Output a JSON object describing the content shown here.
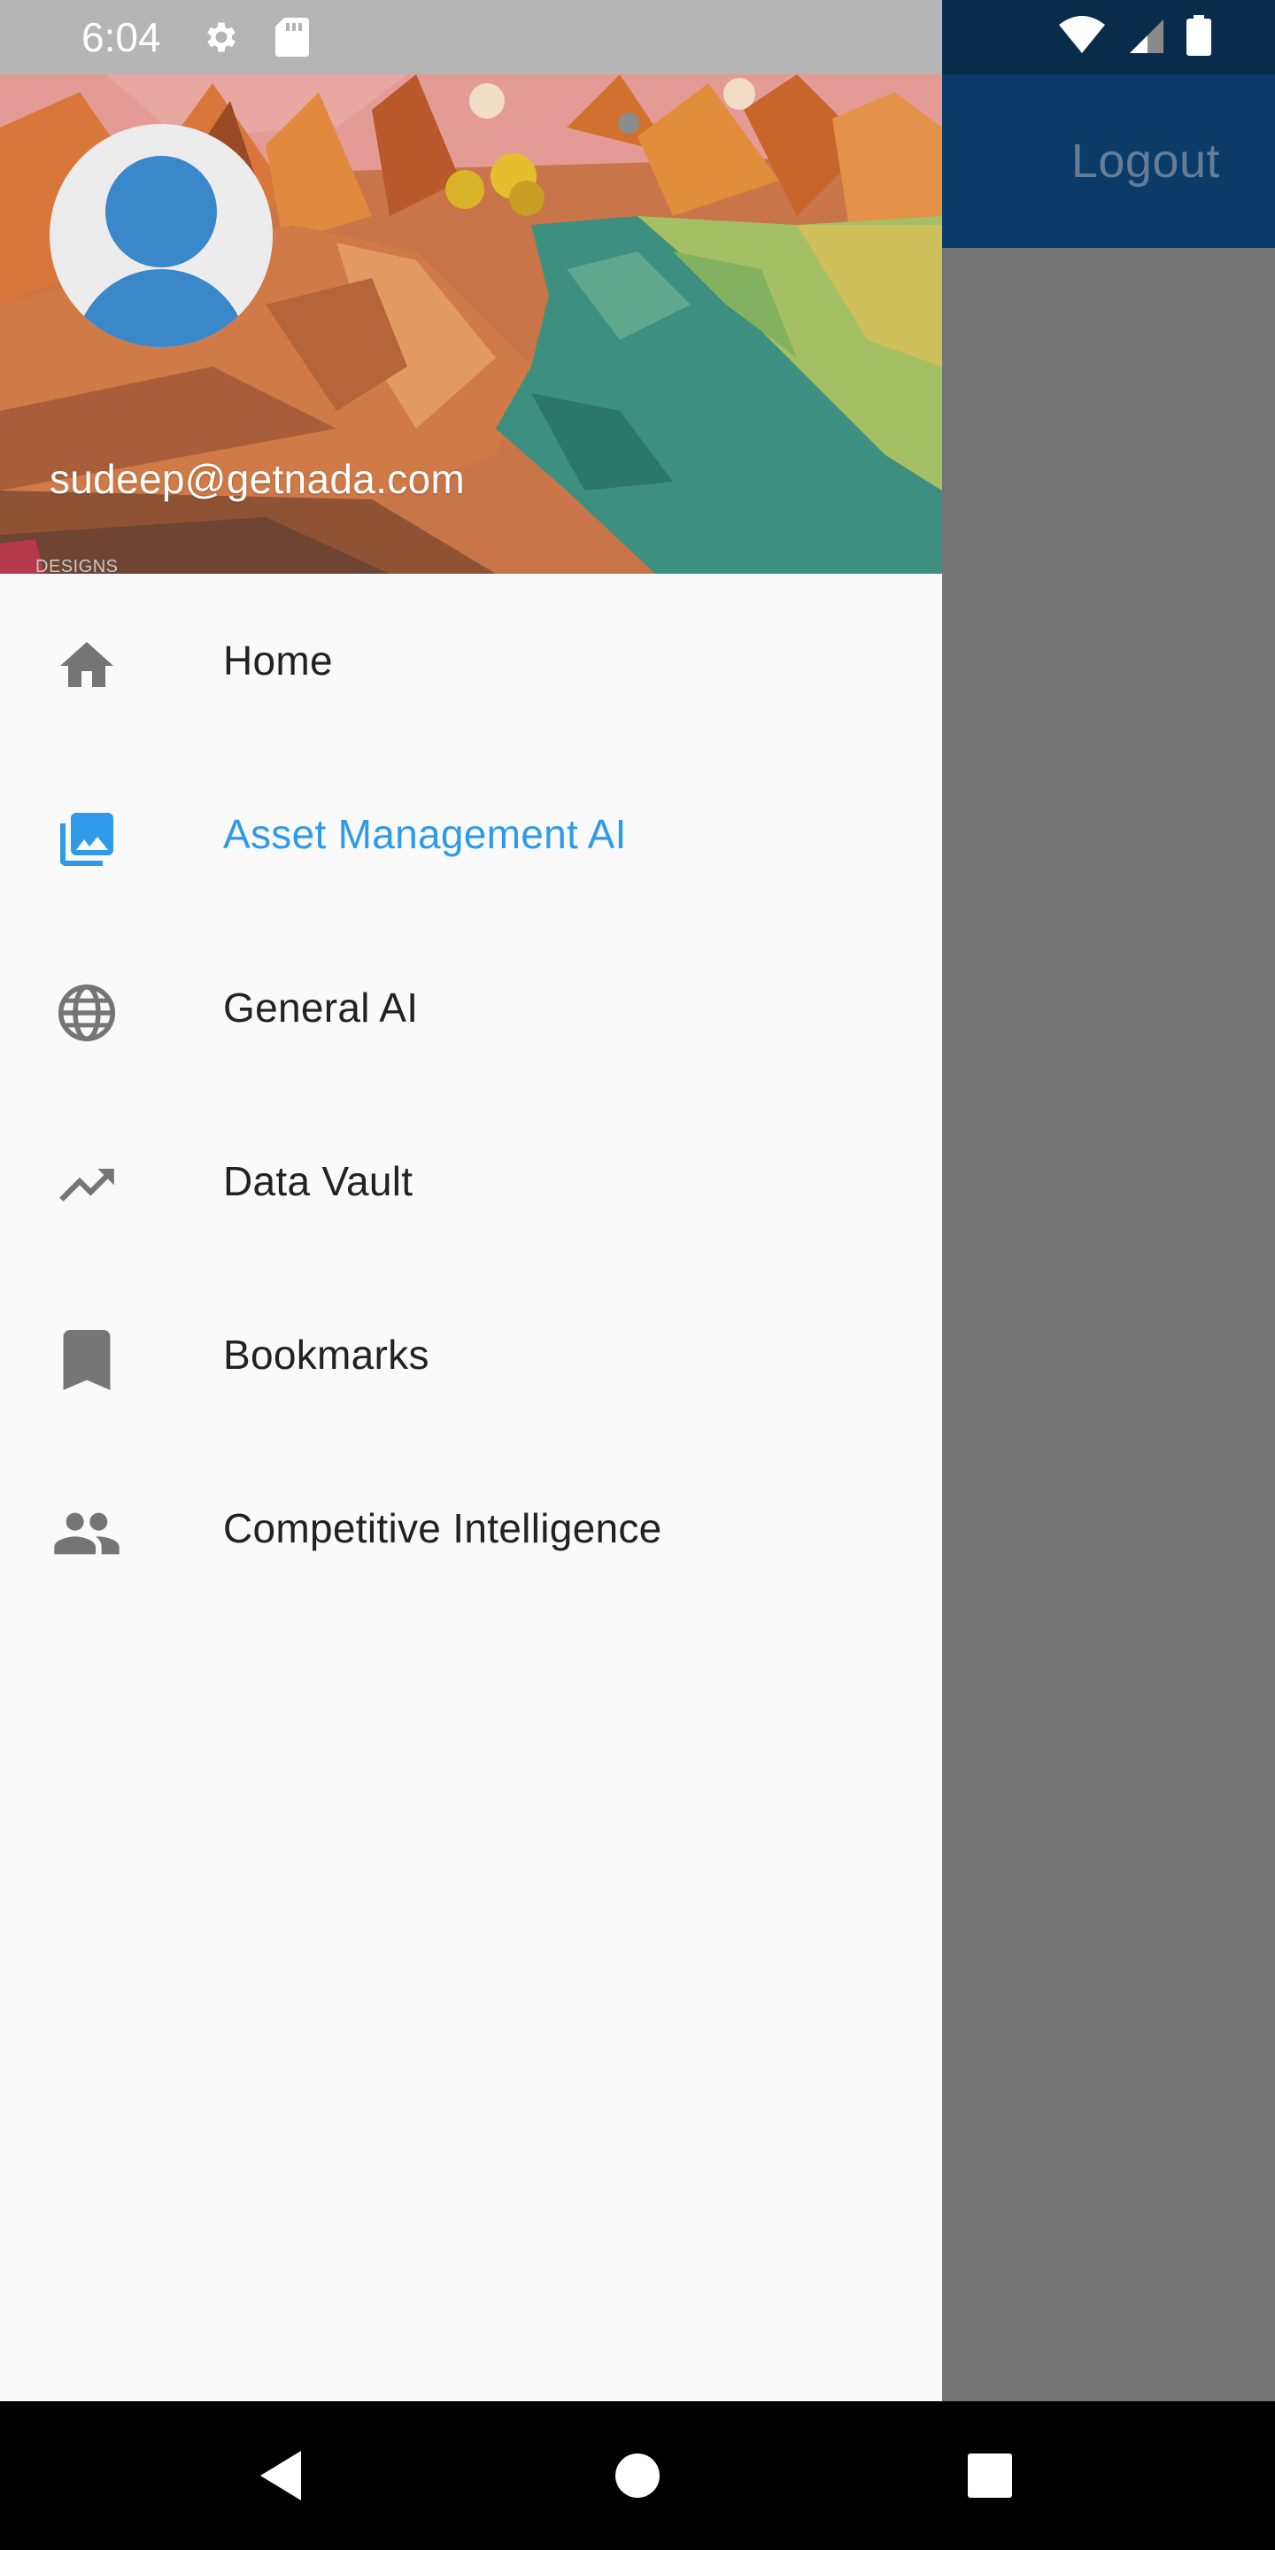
{
  "status_bar": {
    "time": "6:04",
    "left_icons": [
      "gear-icon",
      "sd-card-icon"
    ],
    "right_icons": [
      "wifi-icon",
      "cell-signal-icon",
      "battery-icon"
    ]
  },
  "app_bar": {
    "logout_label": "Logout",
    "color": "#0b3b69"
  },
  "drawer": {
    "header": {
      "email": "sudeep@getnada.com",
      "watermark": "DESIGNS"
    },
    "items": [
      {
        "label": "Home",
        "icon": "home-icon",
        "active": false
      },
      {
        "label": "Asset Management AI",
        "icon": "photo-library-icon",
        "active": true
      },
      {
        "label": "General AI",
        "icon": "globe-icon",
        "active": false
      },
      {
        "label": "Data Vault",
        "icon": "trending-up-icon",
        "active": false
      },
      {
        "label": "Bookmarks",
        "icon": "bookmark-icon",
        "active": false
      },
      {
        "label": "Competitive Intelligence",
        "icon": "people-icon",
        "active": false
      }
    ],
    "active_color": "#2f9be8",
    "text_color": "#222222",
    "icon_color": "#757575"
  },
  "nav_bar": {
    "buttons": [
      "back-icon",
      "home-circle-icon",
      "recents-icon"
    ]
  }
}
